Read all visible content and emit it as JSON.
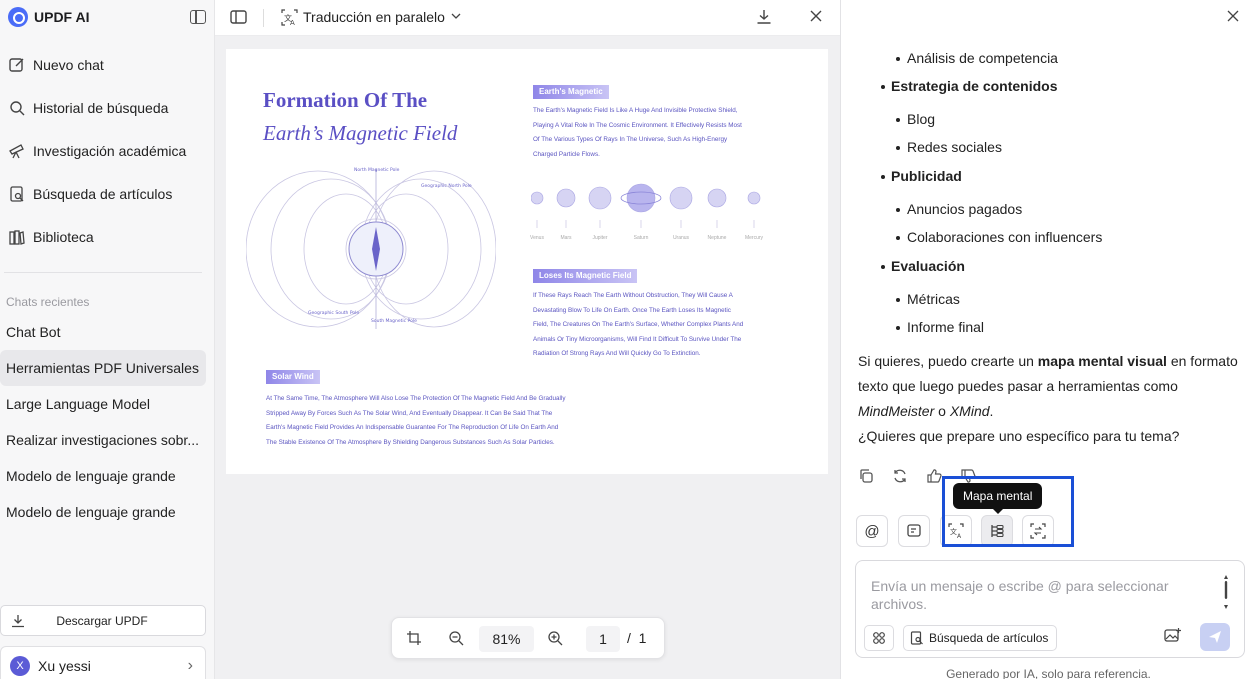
{
  "app": {
    "title": "UPDF AI"
  },
  "sidebar": {
    "nav": [
      {
        "label": "Nuevo chat",
        "icon": "edit-icon"
      },
      {
        "label": "Historial de búsqueda",
        "icon": "search-icon"
      },
      {
        "label": "Investigación académica",
        "icon": "telescope-icon"
      },
      {
        "label": "Búsqueda de artículos",
        "icon": "document-search-icon"
      },
      {
        "label": "Biblioteca",
        "icon": "library-icon"
      }
    ],
    "recent_title": "Chats recientes",
    "recent": [
      "Chat Bot",
      "Herramientas PDF Universales",
      "Large Language Model",
      "Realizar investigaciones sobr...",
      "Modelo de lenguaje grande",
      "Modelo de lenguaje grande"
    ],
    "active_recent_index": 1,
    "download_label": "Descargar UPDF",
    "user": {
      "initial": "X",
      "name": "Xu yessi"
    }
  },
  "document": {
    "mode_label": "Traducción en paralelo",
    "pdf": {
      "title_line1": "Formation Of The",
      "title_line2": "Earth’s Magnetic Field",
      "tag1": "Earth's Magnetic",
      "para1": [
        "The Earth's Magnetic Field Is Like A Huge And Invisible Protective Shield,",
        "Playing A Vital Role In The Cosmic Environment. It Effectively Resists Most",
        "Of The Various Types Of Rays In The Universe, Such As High-Energy",
        "Charged Particle Flows."
      ],
      "tag2": "Loses Its Magnetic Field",
      "para2": [
        "If These Rays Reach The Earth Without Obstruction, They Will Cause A",
        "Devastating Blow To Life On Earth. Once The Earth Loses Its Magnetic",
        "Field, The Creatures On The Earth's Surface, Whether Complex Plants And",
        "Animals Or Tiny Microorganisms, Will Find It Difficult To Survive Under The",
        "Radiation Of Strong Rays And Will Quickly Go To Extinction."
      ],
      "tag3": "Solar Wind",
      "para3": [
        "At The Same Time, The Atmosphere Will Also Lose The Protection Of The Magnetic Field And Be Gradually",
        "Stripped Away By Forces Such As The Solar Wind, And Eventually Disappear. It Can Be Said That The",
        "Earth's Magnetic Field Provides An Indispensable Guarantee For The Reproduction Of Life On Earth And",
        "The Stable Existence Of The Atmosphere By Shielding Dangerous Substances Such As Solar Particles."
      ],
      "diagram_labels": {
        "north_magnetic": "North Magnetic Pole",
        "geo_north": "Geographic North Pole",
        "geo_south": "Geographic South Pole",
        "south_magnetic": "South Magnetic Pole"
      },
      "planets": [
        "Venus",
        "Mars",
        "Jupiter",
        "Saturn",
        "Uranus",
        "Neptune",
        "Mercury"
      ]
    },
    "zoom": "81%",
    "page_current": "1",
    "page_separator": "/",
    "page_total": "1"
  },
  "chat": {
    "bullets": [
      {
        "kind": "item",
        "text": "Análisis de competencia"
      },
      {
        "kind": "head",
        "text": "Estrategia de contenidos"
      },
      {
        "kind": "item",
        "text": "Blog"
      },
      {
        "kind": "item",
        "text": "Redes sociales"
      },
      {
        "kind": "head",
        "text": "Publicidad"
      },
      {
        "kind": "item",
        "text": "Anuncios pagados"
      },
      {
        "kind": "item",
        "text": "Colaboraciones con influencers"
      },
      {
        "kind": "head",
        "text": "Evaluación"
      },
      {
        "kind": "item",
        "text": "Métricas"
      },
      {
        "kind": "item",
        "text": "Informe final"
      }
    ],
    "para_pre": "Si quieres, puedo crearte un ",
    "para_bold": "mapa mental visual",
    "para_mid": " en formato texto que luego puedes pasar a herramientas como ",
    "para_it1": "MindMeister",
    "para_o": " o ",
    "para_it2": "XMind",
    "para_end": ".",
    "question": "¿Quieres que prepare uno específico para tu tema?",
    "tooltip": "Mapa mental",
    "input_placeholder": "Envía un mensaje o escribe @ para seleccionar archivos.",
    "search_chip": "Búsqueda de artículos",
    "footer": "Generado por IA, solo para referencia.",
    "highlight_color": "#1a4fd6"
  }
}
